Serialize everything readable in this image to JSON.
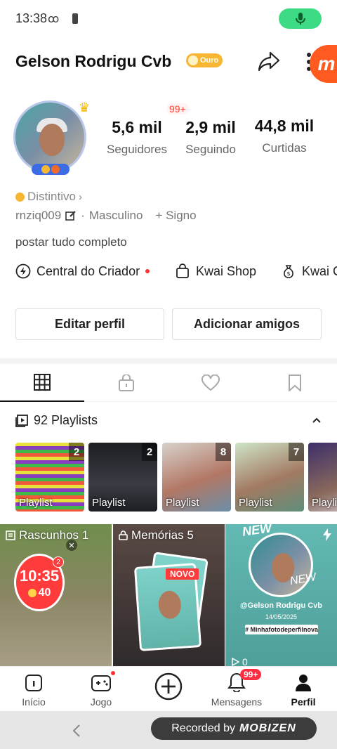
{
  "status": {
    "time": "13:38",
    "voicemail": "ꝏ"
  },
  "profile": {
    "name": "Gelson Rodrigu Cvb",
    "badge": "Ouro",
    "notification": "99+",
    "stats": [
      {
        "value": "5,6 mil",
        "label": "Seguidores"
      },
      {
        "value": "2,9 mil",
        "label": "Seguindo"
      },
      {
        "value": "44,8 mil",
        "label": "Curtidas"
      }
    ],
    "distintivo": "Distintivo",
    "username": "rnziq009",
    "gender": "Masculino",
    "sign": "+ Signo",
    "bio": "postar tudo completo"
  },
  "tools": [
    {
      "label": "Central do Criador",
      "icon": "lightning-icon"
    },
    {
      "label": "Kwai Shop",
      "icon": "shopping-bag-icon"
    },
    {
      "label": "Kwai C",
      "icon": "money-bag-icon"
    }
  ],
  "buttons": {
    "edit": "Editar perfil",
    "add_friends": "Adicionar amigos"
  },
  "playlists": {
    "header": "92 Playlists",
    "items": [
      {
        "label": "Playlist",
        "count": "2",
        "bg": "#6a4aa0"
      },
      {
        "label": "Playlist",
        "count": "2",
        "bg": "#2a2d33"
      },
      {
        "label": "Playlist",
        "count": "8",
        "bg": "#c48a76"
      },
      {
        "label": "Playlist",
        "count": "7",
        "bg": "#8fa68a"
      },
      {
        "label": "Playli",
        "count": "",
        "bg": "#4a3f6b"
      }
    ]
  },
  "posts": [
    {
      "caption": "Rascunhos 1",
      "timer": "10:35",
      "coins": "40",
      "small_badge": "2"
    },
    {
      "caption": "Memórias 5",
      "tag": "NOVO"
    },
    {
      "username": "@Gelson Rodrigu Cvb",
      "date": "14/05/2025",
      "hashtag": "# Minhafotodeperfilnova",
      "new_text": "NEW",
      "new_text2": "NEW",
      "views": "0"
    }
  ],
  "nav": [
    {
      "label": "Início"
    },
    {
      "label": "Jogo"
    },
    {
      "label": ""
    },
    {
      "label": "Mensagens",
      "badge": "99+"
    },
    {
      "label": "Perfil"
    }
  ],
  "recorder": {
    "prefix": "Recorded by",
    "brand": "MOBIZEN"
  },
  "fab_letter": "m"
}
